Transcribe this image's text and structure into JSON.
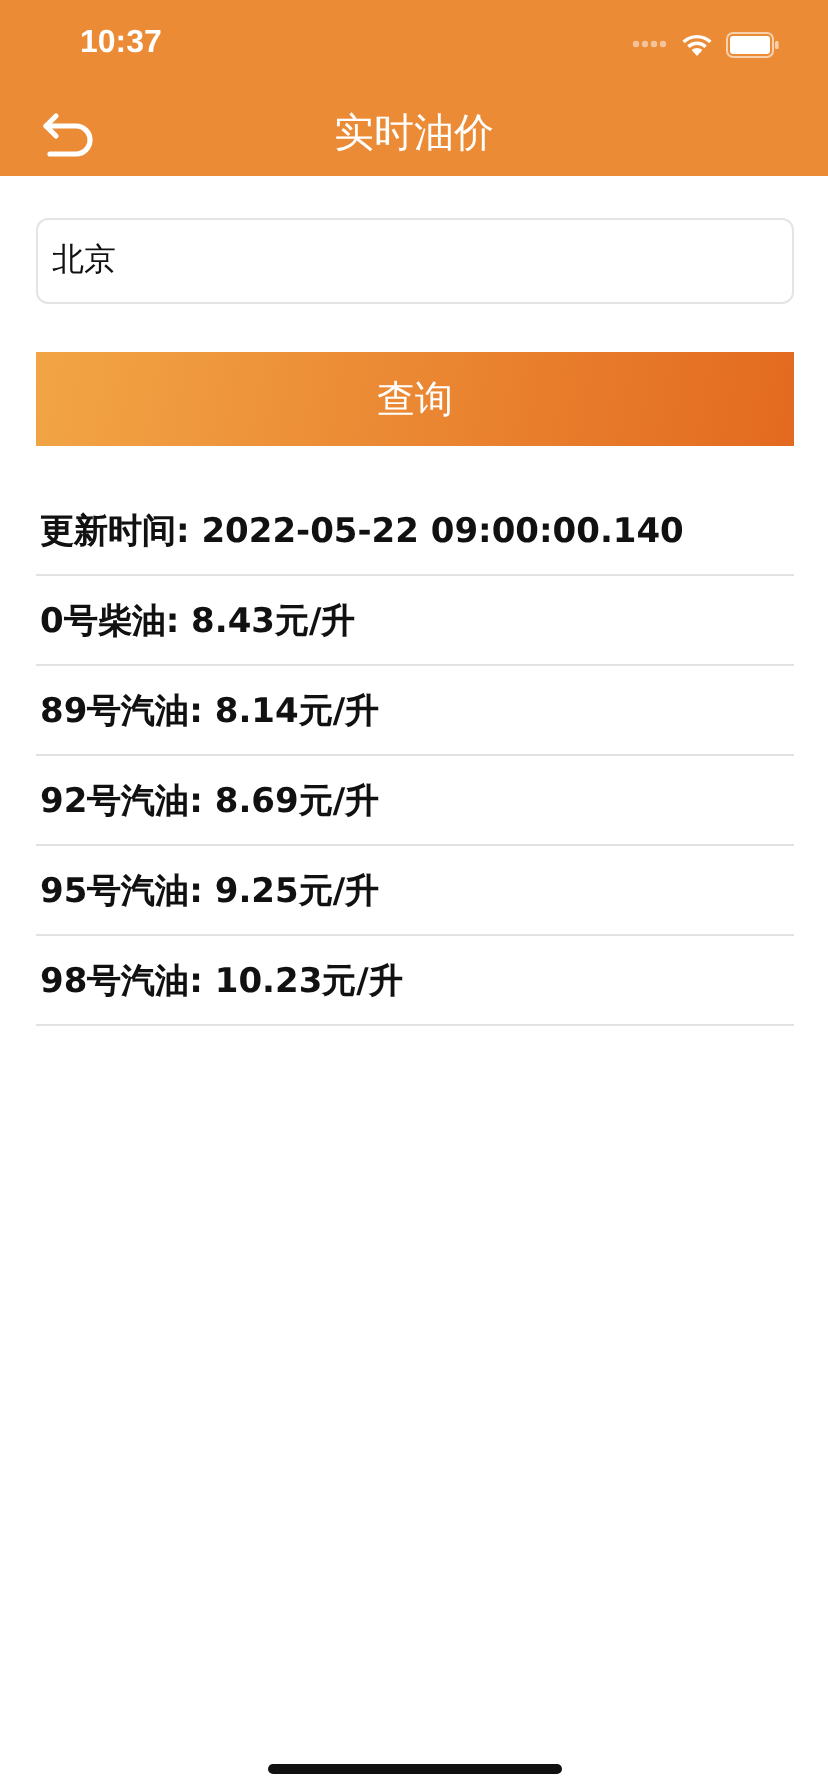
{
  "status_bar": {
    "time": "10:37"
  },
  "nav": {
    "title": "实时油价"
  },
  "search": {
    "value": "北京"
  },
  "query_button": "查询",
  "rows": [
    "更新时间: 2022-05-22 09:00:00.140",
    "0号柴油: 8.43元/升",
    "89号汽油: 8.14元/升",
    "92号汽油: 8.69元/升",
    "95号汽油: 9.25元/升",
    "98号汽油: 10.23元/升"
  ]
}
